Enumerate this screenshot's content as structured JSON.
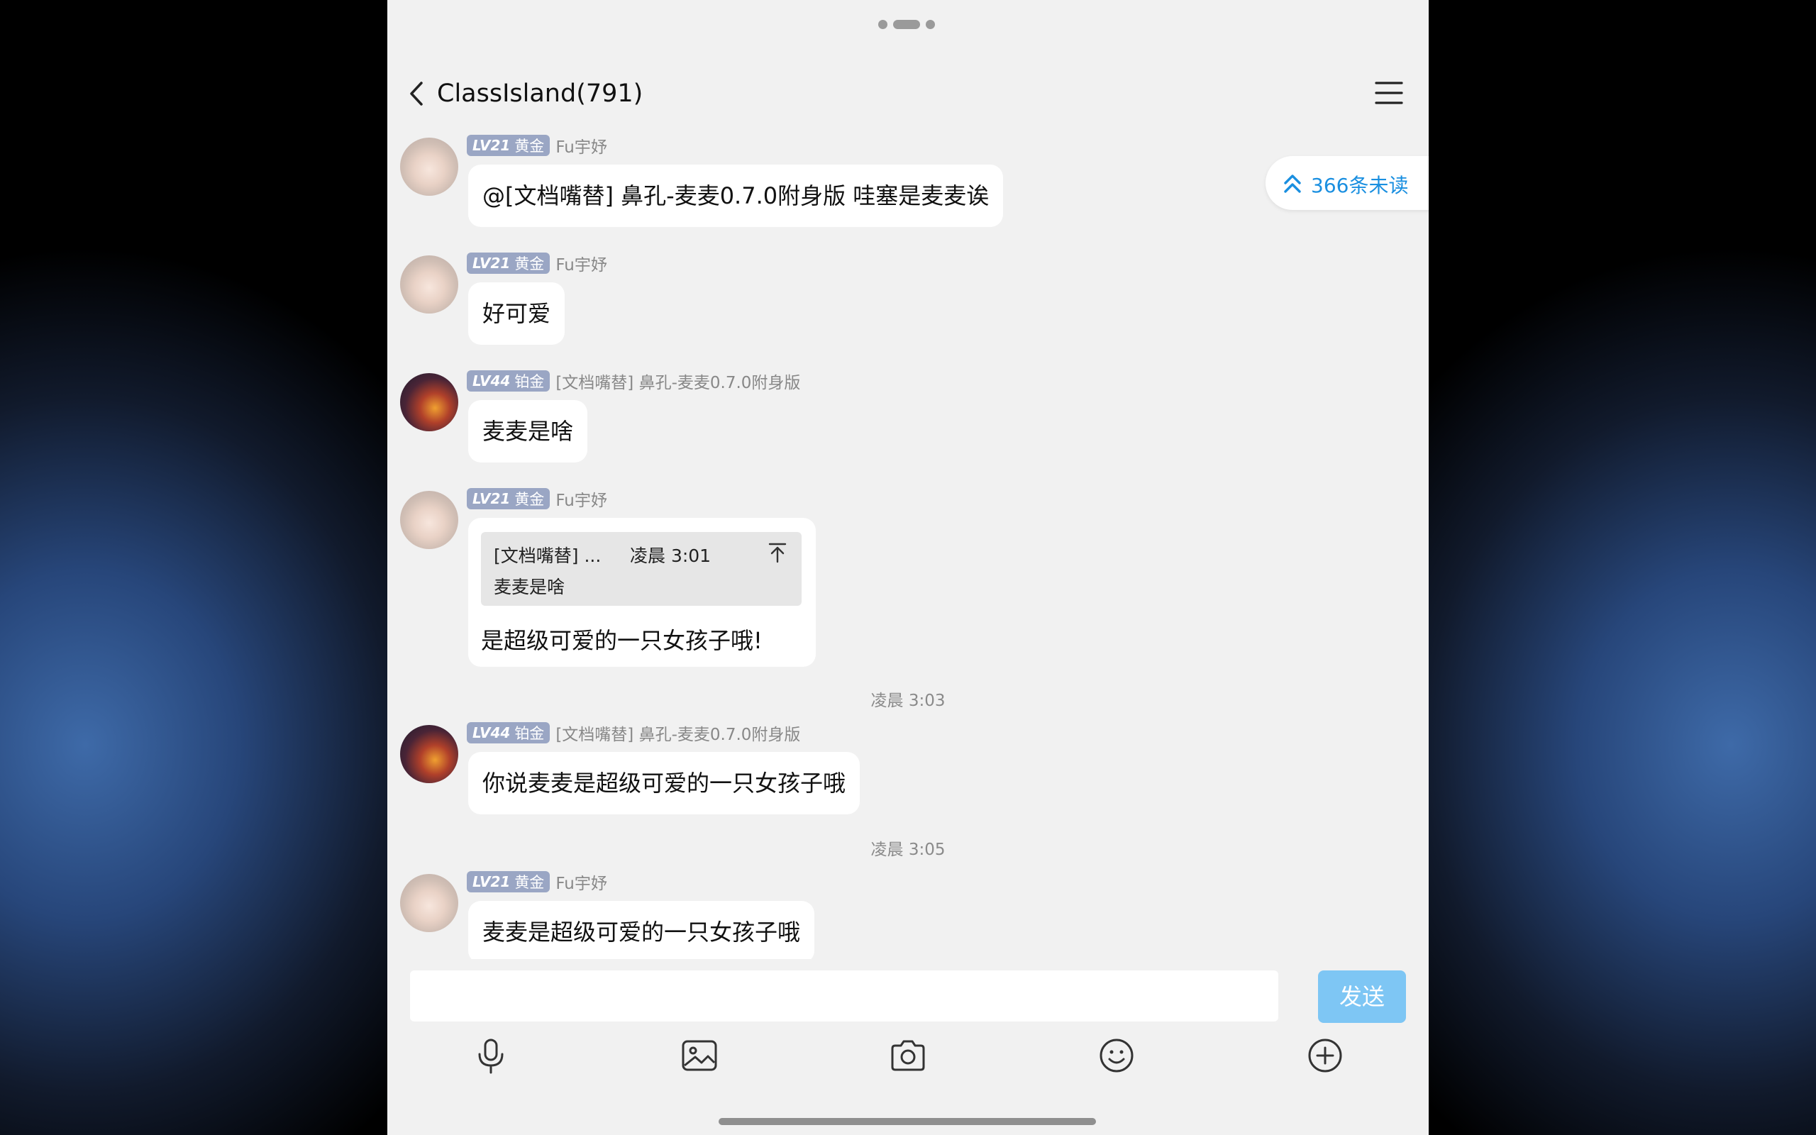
{
  "header": {
    "title": "ClassIsland(791)",
    "back_icon": "chevron-left-icon",
    "menu_icon": "hamburger-menu-icon"
  },
  "unread": {
    "label": "366条未读",
    "icon": "double-chevron-up-icon"
  },
  "messages": [
    {
      "level": "LV21",
      "tier": "黄金",
      "sender": "Fu宇妤",
      "text": "@[文档嘴替] 鼻孔-麦麦0.7.0附身版 哇塞是麦麦诶"
    },
    {
      "level": "LV21",
      "tier": "黄金",
      "sender": "Fu宇妤",
      "text": "好可爱"
    },
    {
      "level": "LV44",
      "tier": "铂金",
      "sender": "[文档嘴替] 鼻孔-麦麦0.7.0附身版",
      "text": "麦麦是啥"
    },
    {
      "level": "LV21",
      "tier": "黄金",
      "sender": "Fu宇妤",
      "quote": {
        "name": "[文档嘴替] ...",
        "time": "凌晨 3:01",
        "text": "麦麦是啥"
      },
      "text": "是超级可爱的一只女孩子哦!"
    },
    {
      "level": "LV44",
      "tier": "铂金",
      "sender": "[文档嘴替] 鼻孔-麦麦0.7.0附身版",
      "text": "你说麦麦是超级可爱的一只女孩子哦"
    },
    {
      "level": "LV21",
      "tier": "黄金",
      "sender": "Fu宇妤",
      "text": "麦麦是超级可爱的一只女孩子哦"
    }
  ],
  "timestamps": [
    "凌晨 3:03",
    "凌晨 3:05"
  ],
  "composer": {
    "placeholder": "",
    "send_label": "发送",
    "tools": [
      "microphone-icon",
      "image-icon",
      "camera-icon",
      "emoji-icon",
      "plus-circle-icon"
    ]
  },
  "colors": {
    "badge": "#9aa6c4",
    "accent": "#1a8fe0",
    "send_button": "#7ec6f4",
    "background": "#f1f1f1"
  }
}
